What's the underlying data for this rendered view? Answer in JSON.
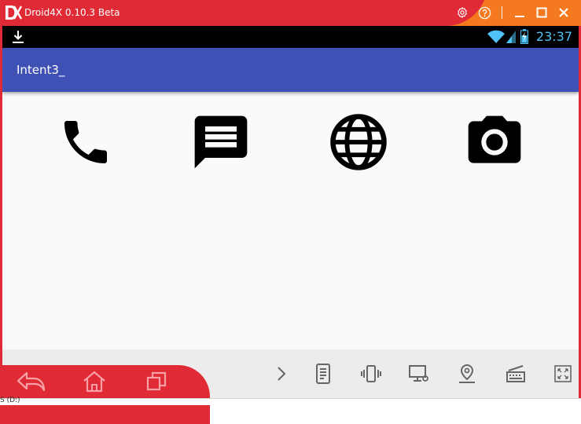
{
  "window": {
    "title": "Droid4X 0.10.3 Beta",
    "buttons": [
      "settings-icon",
      "help-icon",
      "minimize-icon",
      "maximize-icon",
      "close-icon"
    ]
  },
  "status_bar": {
    "time": "23:37",
    "icons": [
      "download-icon",
      "wifi-icon",
      "signal-icon",
      "battery-icon"
    ]
  },
  "app_bar": {
    "title": "Intent3_"
  },
  "actions": [
    {
      "icon": "phone-icon"
    },
    {
      "icon": "message-icon"
    },
    {
      "icon": "globe-icon"
    },
    {
      "icon": "camera-icon"
    }
  ],
  "navigation": [
    "back-icon",
    "home-icon",
    "recent-apps-icon"
  ],
  "toolbar": [
    "chevron-right-icon",
    "apk-install-icon",
    "shake-icon",
    "screen-record-icon",
    "location-icon",
    "keyboard-icon",
    "fullscreen-icon"
  ],
  "taskbar": {
    "drive_label": "S (D:)"
  },
  "colors": {
    "titlebar_red": "#e02a35",
    "titlebar_orange": "#f5791f",
    "appbar_blue": "#3f51b5",
    "status_time": "#4fc3f7"
  }
}
